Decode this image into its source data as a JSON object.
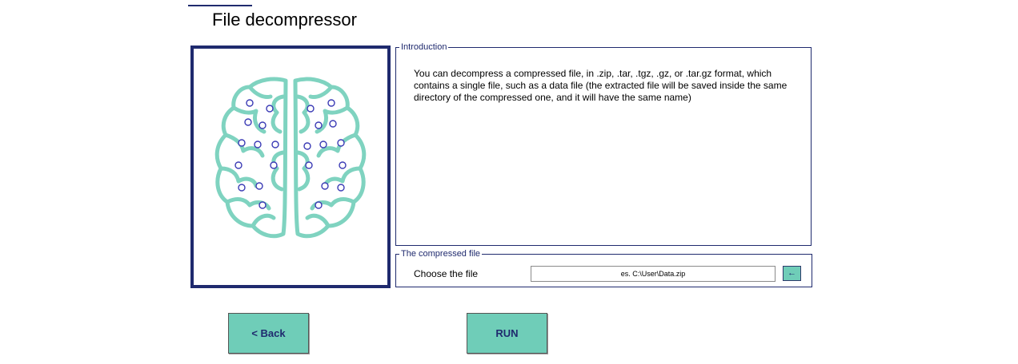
{
  "header": {
    "title": "File decompressor"
  },
  "intro": {
    "legend": "Introduction",
    "text": "You can decompress a compressed file, in .zip, .tar, .tgz, .gz, or .tar.gz format, which contains a single file, such as a data file (the extracted file will be saved inside the same directory of the compressed one, and it will have the same name)"
  },
  "file_group": {
    "legend": "The compressed file",
    "choose_label": "Choose the file",
    "input_value": "es. C:\\User\\Data.zip",
    "browse_icon": "arrow-left-icon",
    "browse_glyph": "←"
  },
  "buttons": {
    "back_label": "<  Back",
    "run_label": "RUN"
  },
  "colors": {
    "accent": "#6fcdb8",
    "navy": "#1f2a6e",
    "brain": "#7fd3c0",
    "node": "#3b3bb5"
  }
}
